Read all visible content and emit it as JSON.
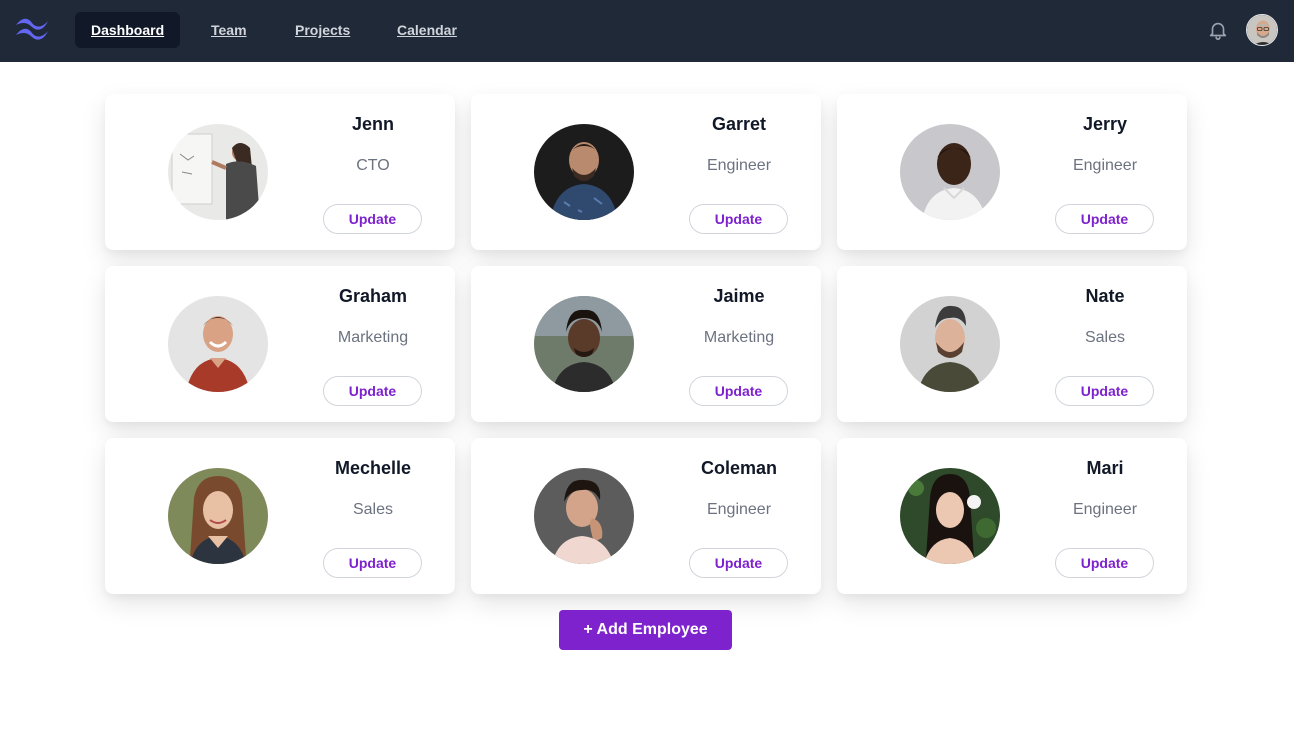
{
  "nav": {
    "links": [
      {
        "label": "Dashboard",
        "active": true
      },
      {
        "label": "Team",
        "active": false
      },
      {
        "label": "Projects",
        "active": false
      },
      {
        "label": "Calendar",
        "active": false
      }
    ],
    "icons": [
      "logo-icon",
      "bell-icon",
      "user-avatar"
    ]
  },
  "employees": [
    {
      "name": "Jenn",
      "role": "CTO",
      "button": "Update"
    },
    {
      "name": "Garret",
      "role": "Engineer",
      "button": "Update"
    },
    {
      "name": "Jerry",
      "role": "Engineer",
      "button": "Update"
    },
    {
      "name": "Graham",
      "role": "Marketing",
      "button": "Update"
    },
    {
      "name": "Jaime",
      "role": "Marketing",
      "button": "Update"
    },
    {
      "name": "Nate",
      "role": "Sales",
      "button": "Update"
    },
    {
      "name": "Mechelle",
      "role": "Sales",
      "button": "Update"
    },
    {
      "name": "Coleman",
      "role": "Engineer",
      "button": "Update"
    },
    {
      "name": "Mari",
      "role": "Engineer",
      "button": "Update"
    }
  ],
  "actions": {
    "add_employee": "+ Add Employee"
  },
  "colors": {
    "navbar": "#1f2937",
    "accent": "#7e22ce",
    "logo": "#6366f1"
  }
}
